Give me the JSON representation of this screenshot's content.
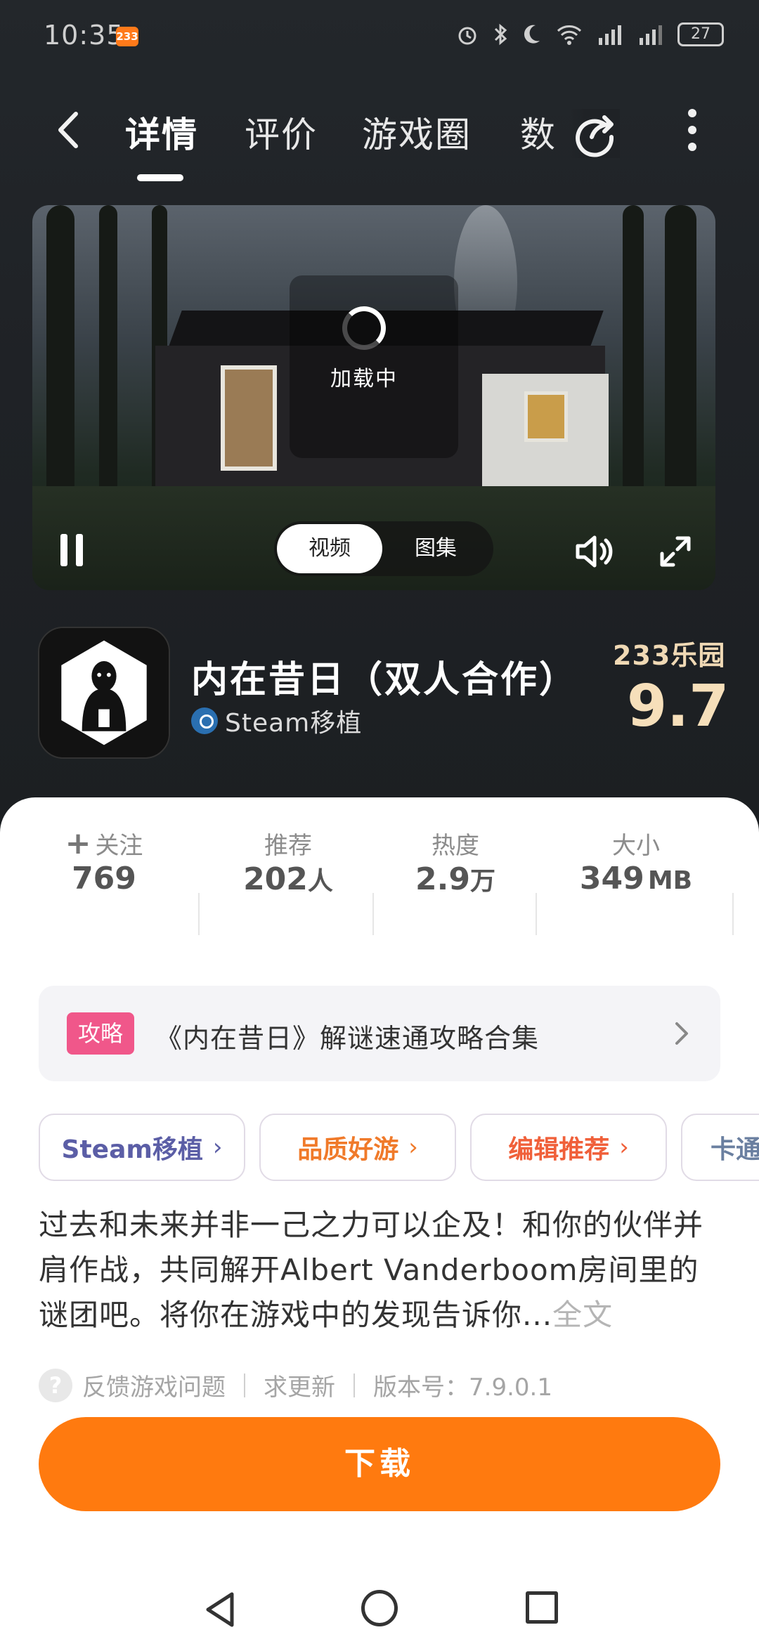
{
  "status_bar": {
    "time": "10:35",
    "badge": "233",
    "battery": "27",
    "icons": [
      "alarm-icon",
      "bluetooth-icon",
      "moon-icon",
      "wifi-icon",
      "signal-4g-icon",
      "signal-4g-icon"
    ]
  },
  "nav": {
    "tabs": [
      {
        "label": "详情",
        "active": true
      },
      {
        "label": "评价",
        "active": false
      },
      {
        "label": "游戏圈",
        "active": false
      },
      {
        "label": "数",
        "active": false
      }
    ]
  },
  "media": {
    "loading_text": "加载中",
    "segments": [
      {
        "label": "视频",
        "active": true
      },
      {
        "label": "图集",
        "active": false
      }
    ]
  },
  "game": {
    "title": "内在昔日（双人合作）",
    "subtitle": "Steam移植",
    "brand": "233乐园",
    "score": "9.7"
  },
  "stats": [
    {
      "label": "关注",
      "value": "769",
      "unit": "",
      "has_plus": true
    },
    {
      "label": "推荐",
      "value": "202",
      "unit": "人",
      "has_plus": false
    },
    {
      "label": "热度",
      "value": "2.9",
      "unit": "万",
      "has_plus": false
    },
    {
      "label": "大小",
      "value": "349",
      "unit": "MB",
      "has_plus": false
    }
  ],
  "guide": {
    "tag": "攻略",
    "text": "《内在昔日》解谜速通攻略合集"
  },
  "chips": [
    {
      "label": "Steam移植",
      "color": "#5b5ea6"
    },
    {
      "label": "品质好游",
      "color": "#f07a2a"
    },
    {
      "label": "编辑推荐",
      "color": "#f0603a"
    },
    {
      "label": "卡通",
      "color": "#6a7fa0"
    }
  ],
  "description": {
    "text": "过去和未来并非一己之力可以企及！和你的伙伴并肩作战，共同解开Albert Vanderboom房间里的谜团吧。将你在游戏中的发现告诉你...",
    "more_label": "全文"
  },
  "footer": {
    "feedback": "反馈游戏问题",
    "request_update": "求更新",
    "version": "版本号：7.9.0.1"
  },
  "download_label": "下载",
  "colors": {
    "accent": "#ff7a0f",
    "guide_tag": "#f0578a",
    "score": "#f6dfba"
  }
}
